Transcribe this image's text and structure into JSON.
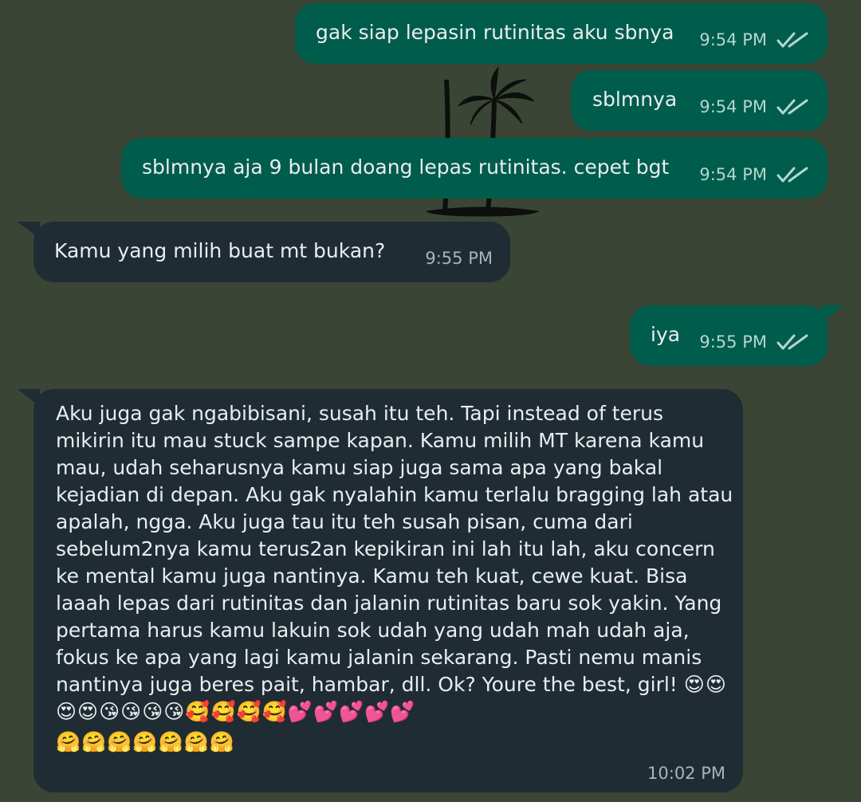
{
  "messages": [
    {
      "id": "m1",
      "direction": "outgoing",
      "text": "gak siap lepasin rutinitas aku sbnya",
      "time": "9:54 PM",
      "status": "read"
    },
    {
      "id": "m2",
      "direction": "outgoing",
      "text": "sblmnya",
      "time": "9:54 PM",
      "status": "read"
    },
    {
      "id": "m3",
      "direction": "outgoing",
      "text": "sblmnya aja 9 bulan doang lepas rutinitas. cepet bgt",
      "time": "9:54 PM",
      "status": "read"
    },
    {
      "id": "m4",
      "direction": "incoming",
      "text": "Kamu yang milih buat mt bukan?",
      "time": "9:55 PM"
    },
    {
      "id": "m5",
      "direction": "outgoing",
      "text": "iya",
      "time": "9:55 PM",
      "status": "read"
    },
    {
      "id": "m6",
      "direction": "incoming",
      "text": "Aku juga gak ngabibisani, susah itu teh. Tapi instead of terus mikirin itu mau stuck sampe kapan. Kamu milih MT karena kamu mau, udah seharusnya kamu siap juga sama apa yang bakal kejadian di depan. Aku gak nyalahin kamu terlalu bragging lah atau apalah, ngga. Aku juga tau itu teh susah pisan, cuma dari sebelum2nya kamu terus2an kepikiran ini lah itu lah, aku concern ke mental kamu juga nantinya. Kamu teh kuat, cewe kuat. Bisa laaah lepas dari rutinitas dan jalanin rutinitas baru sok yakin. Yang pertama harus kamu lakuin sok udah yang udah mah udah aja, fokus ke apa yang lagi kamu jalanin sekarang. Pasti nemu manis nantinya juga beres pait, hambar, dll. Ok? Youre the best, girl!",
      "emoji_line_1": "😍😍😍😍😘😘😘😘🥰🥰🥰🥰💕💕💕💕💕",
      "emoji_line_2": "🤗🤗🤗🤗🤗🤗🤗",
      "time": "10:02 PM"
    }
  ],
  "colors": {
    "background": "#3a4536",
    "outgoing_bubble": "#005c4b",
    "incoming_bubble": "#1f2c33",
    "read_check": "#b5d6cd"
  },
  "icons": {
    "read_receipt": "double-check-icon",
    "wallpaper": "palm-tree-icon"
  }
}
